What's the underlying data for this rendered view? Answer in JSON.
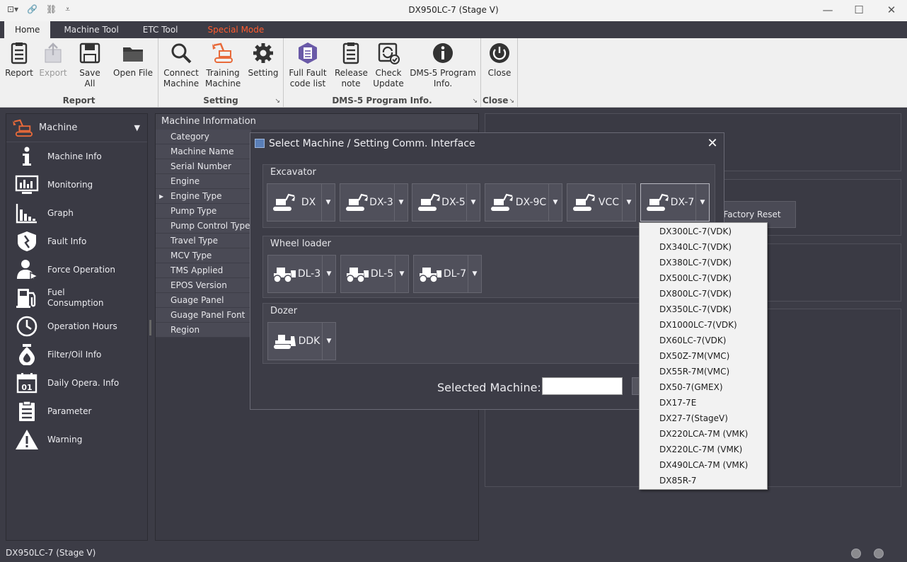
{
  "window": {
    "title": "DX950LC-7 (Stage V)",
    "controls": {
      "minimize": "—",
      "maximize": "☐",
      "close": "✕"
    }
  },
  "tabs": [
    {
      "label": "Home"
    },
    {
      "label": "Machine Tool"
    },
    {
      "label": "ETC Tool"
    },
    {
      "label": "Special Mode"
    }
  ],
  "ribbon": {
    "groups": {
      "report": "Report",
      "setting": "Setting",
      "dms": "DMS-5 Program Info.",
      "close": "Close"
    },
    "buttons": {
      "report": [
        "Report"
      ],
      "export": [
        "Export"
      ],
      "save_all": [
        "Save All"
      ],
      "open_file": [
        "Open File"
      ],
      "connect": [
        "Connect",
        "Machine"
      ],
      "training": [
        "Training",
        "Machine"
      ],
      "setting": [
        "Setting"
      ],
      "full_fault": [
        "Full Fault",
        "code list"
      ],
      "release": [
        "Release",
        "note"
      ],
      "check_update": [
        "Check",
        "Update"
      ],
      "dms_info": [
        "DMS-5 Program",
        "Info."
      ],
      "close": [
        "Close"
      ]
    }
  },
  "nav": {
    "header": "Machine",
    "items": [
      {
        "label": "Machine Info",
        "icon": "info-icon"
      },
      {
        "label": "Monitoring",
        "icon": "monitor-icon"
      },
      {
        "label": "Graph",
        "icon": "graph-icon"
      },
      {
        "label": "Fault Info",
        "icon": "fault-icon"
      },
      {
        "label": "Force Operation",
        "icon": "force-operation-icon"
      },
      {
        "label": "Fuel\nConsumption",
        "icon": "fuel-icon"
      },
      {
        "label": "Operation Hours",
        "icon": "clock-icon"
      },
      {
        "label": "Filter/Oil Info",
        "icon": "oil-drop-icon"
      },
      {
        "label": "Daily Opera. Info",
        "icon": "calendar-icon"
      },
      {
        "label": "Parameter",
        "icon": "clipboard-icon"
      },
      {
        "label": "Warning",
        "icon": "warning-icon"
      }
    ]
  },
  "machine_info": {
    "title": "Machine Information",
    "rows": [
      "Category",
      "Machine Name",
      "Serial Number",
      "Engine Manufacturer",
      "Engine Type",
      "Pump Type",
      "Pump Control Type",
      "Travel Type",
      "MCV Type",
      "TMS Applied",
      "EPOS Version",
      "Guage Panel Version",
      "Guage Panel Font Ve",
      "Region"
    ]
  },
  "factory_reset": "Factory Reset",
  "status": {
    "text": "DX950LC-7 (Stage V)"
  },
  "dialog": {
    "title": "Select Machine / Setting Comm. Interface",
    "excavator": {
      "label": "Excavator",
      "buttons": [
        "DX",
        "DX-3",
        "DX-5",
        "DX-9C",
        "VCC",
        "DX-7"
      ]
    },
    "wheel_loader": {
      "label": "Wheel loader",
      "buttons": [
        "DL-3",
        "DL-5",
        "DL-7"
      ]
    },
    "dozer": {
      "label": "Dozer",
      "buttons": [
        "DDK"
      ]
    },
    "selected_label": "Selected Machine:",
    "selected_value": ""
  },
  "dropdown": {
    "items": [
      "DX300LC-7(VDK)",
      "DX340LC-7(VDK)",
      "DX380LC-7(VDK)",
      "DX500LC-7(VDK)",
      "DX800LC-7(VDK)",
      "DX350LC-7(VDK)",
      "DX1000LC-7(VDK)",
      "DX60LC-7(VDK)",
      "DX50Z-7M(VMC)",
      "DX55R-7M(VMC)",
      "DX50-7(GMEX)",
      "DX17-7E",
      "DX27-7(StageV)",
      "DX220LCA-7M (VMK)",
      "DX220LC-7M (VMK)",
      "DX490LCA-7M (VMK)",
      "DX85R-7"
    ]
  },
  "colors": {
    "accent": "#ff5b2e",
    "bg": "#3c3c46",
    "ribbon": "#f0f0f0"
  }
}
